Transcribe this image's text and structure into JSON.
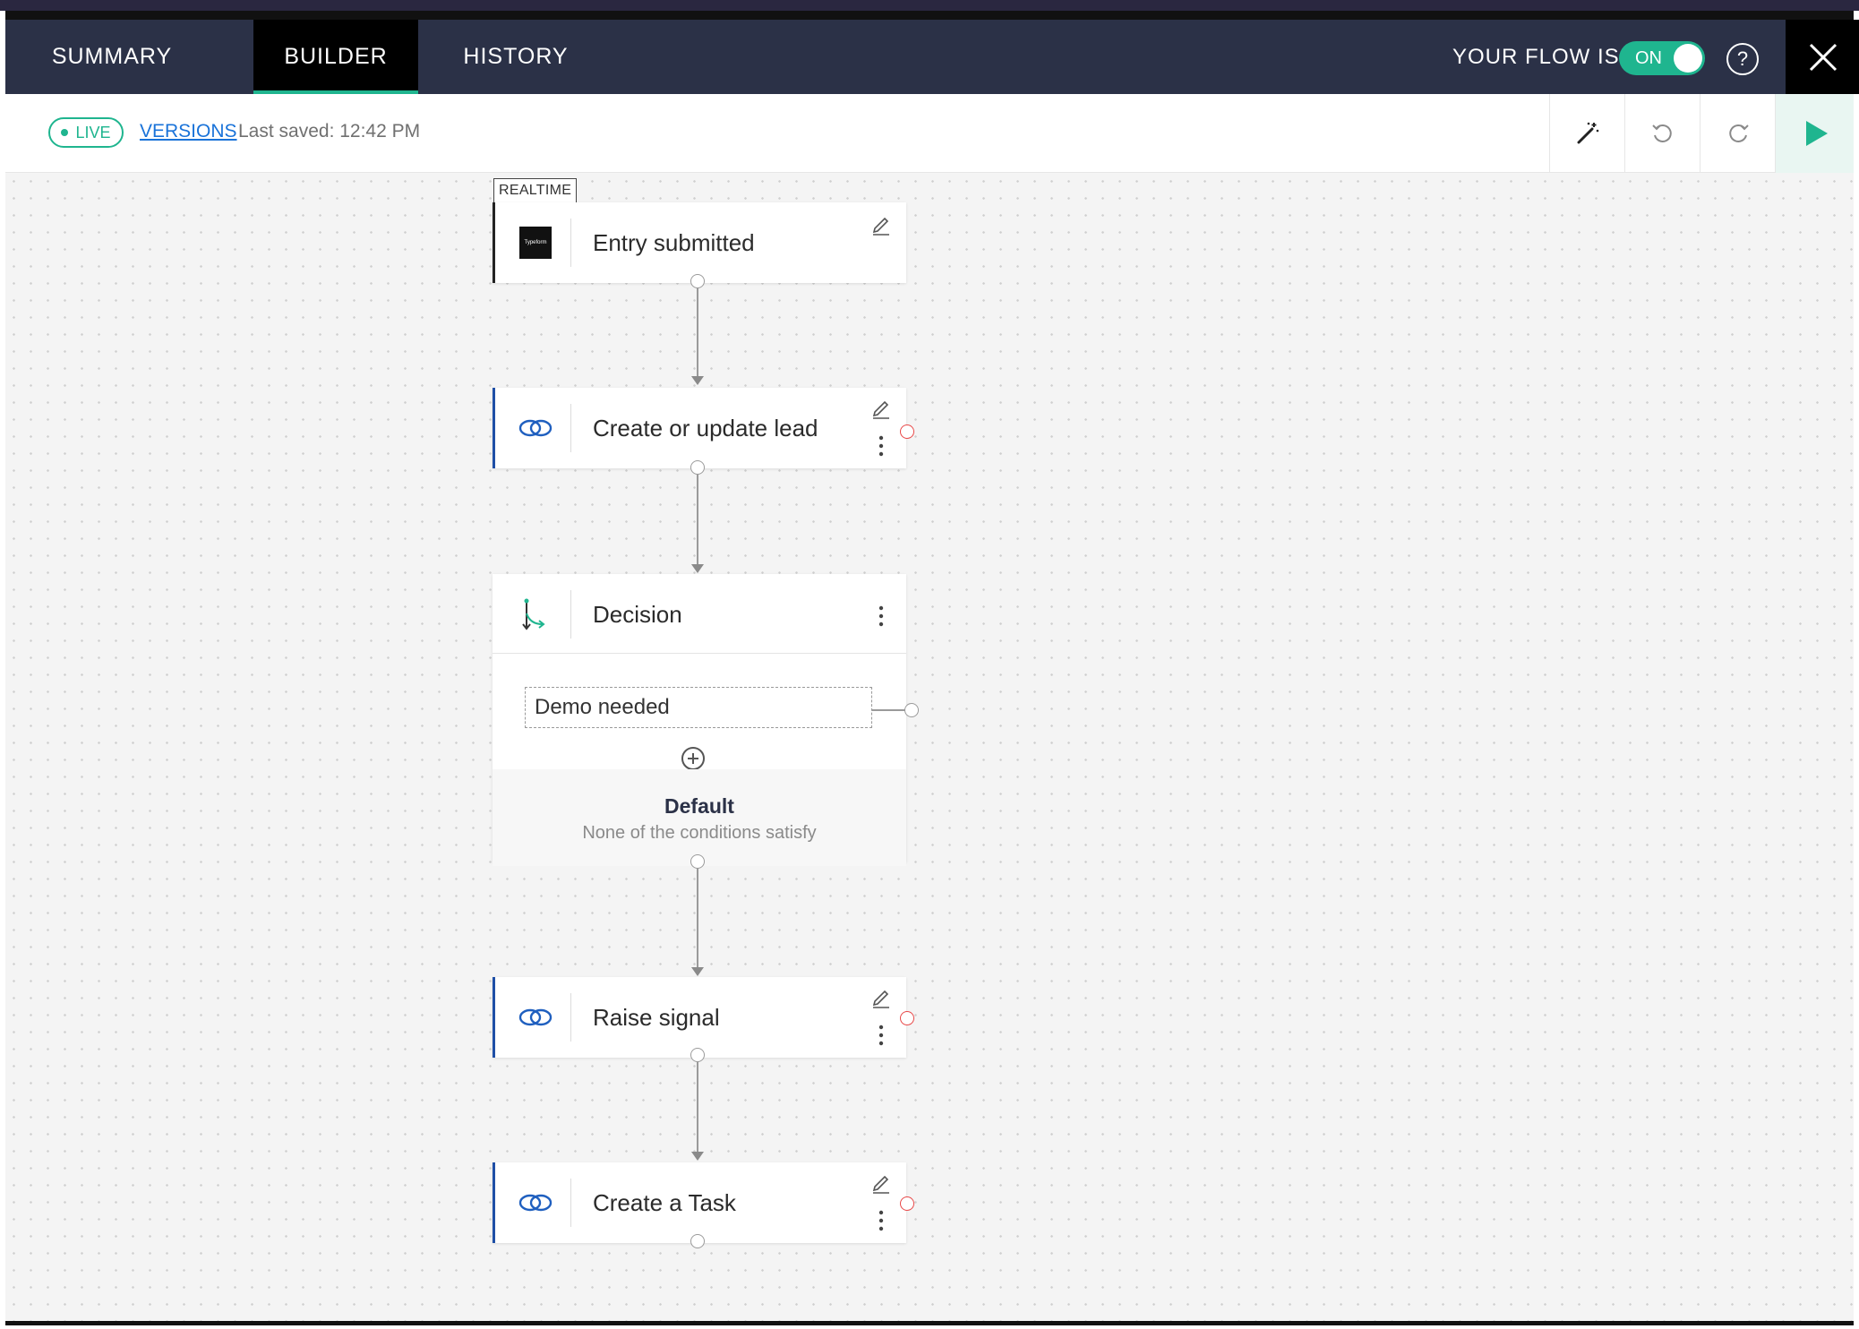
{
  "header": {
    "tabs": [
      {
        "label": "SUMMARY",
        "active": false
      },
      {
        "label": "BUILDER",
        "active": true
      },
      {
        "label": "HISTORY",
        "active": false
      }
    ],
    "flow_label": "YOUR FLOW IS",
    "toggle_label": "ON",
    "help_label": "?",
    "close_icon": "close-icon"
  },
  "toolbar": {
    "live_label": "LIVE",
    "versions_label": "VERSIONS",
    "last_saved": "Last saved: 12:42 PM",
    "tools": [
      "magic-wand-icon",
      "undo-icon",
      "redo-icon",
      "play-icon"
    ]
  },
  "canvas": {
    "trigger_badge": "REALTIME",
    "nodes": [
      {
        "title": "Entry submitted",
        "icon": "typeform-icon",
        "icon_text": "Typeform"
      },
      {
        "title": "Create or update lead",
        "icon": "link-icon"
      },
      {
        "title": "Decision",
        "icon": "decision-icon"
      },
      {
        "title": "Raise signal",
        "icon": "link-icon"
      },
      {
        "title": "Create a Task",
        "icon": "link-icon"
      }
    ],
    "decision": {
      "conditions": [
        "Demo needed"
      ],
      "default_title": "Default",
      "default_subtitle": "None of the conditions satisfy"
    }
  },
  "colors": {
    "header_bg": "#2b3147",
    "accent_green": "#1fb58f",
    "link_blue": "#1a73d9",
    "node_accent": "#1f4fa6",
    "error_red": "#e84848"
  }
}
